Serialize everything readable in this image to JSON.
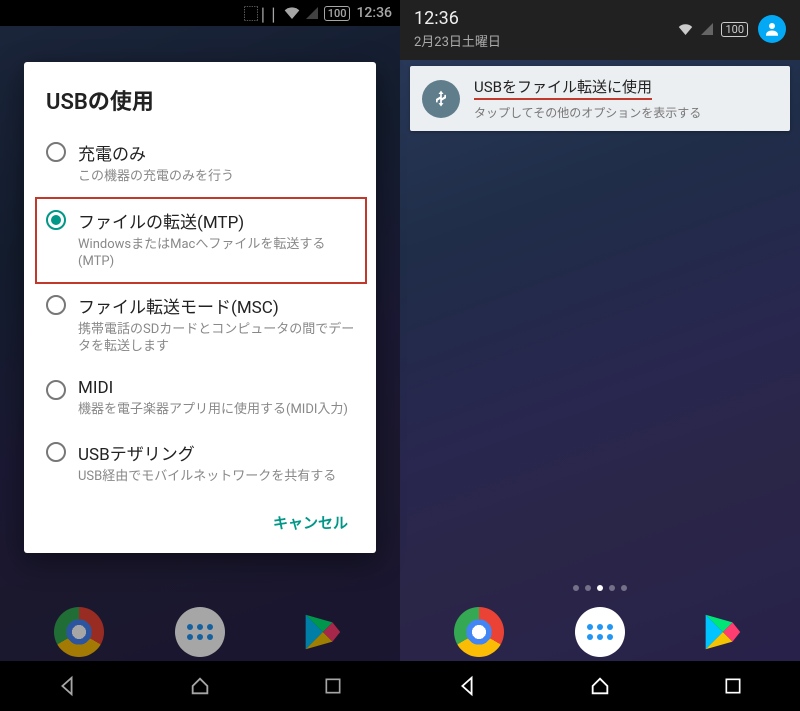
{
  "left": {
    "status": {
      "time": "12:36",
      "battery": "100"
    },
    "dialog": {
      "title": "USBの使用",
      "options": [
        {
          "label": "充電のみ",
          "desc": "この機器の充電のみを行う",
          "checked": false,
          "highlighted": false
        },
        {
          "label": "ファイルの転送(MTP)",
          "desc": "WindowsまたはMacへファイルを転送する(MTP)",
          "checked": true,
          "highlighted": true
        },
        {
          "label": "ファイル転送モード(MSC)",
          "desc": "携帯電話のSDカードとコンピュータの間でデータを転送します",
          "checked": false,
          "highlighted": false
        },
        {
          "label": "MIDI",
          "desc": "機器を電子楽器アプリ用に使用する(MIDI入力)",
          "checked": false,
          "highlighted": false
        },
        {
          "label": "USBテザリング",
          "desc": "USB経由でモバイルネットワークを共有する",
          "checked": false,
          "highlighted": false
        }
      ],
      "cancel": "キャンセル"
    }
  },
  "right": {
    "shade": {
      "time": "12:36",
      "date": "2月23日土曜日",
      "battery": "100"
    },
    "notification": {
      "title": "USBをファイル転送に使用",
      "subtitle": "タップしてその他のオプションを表示する"
    }
  }
}
